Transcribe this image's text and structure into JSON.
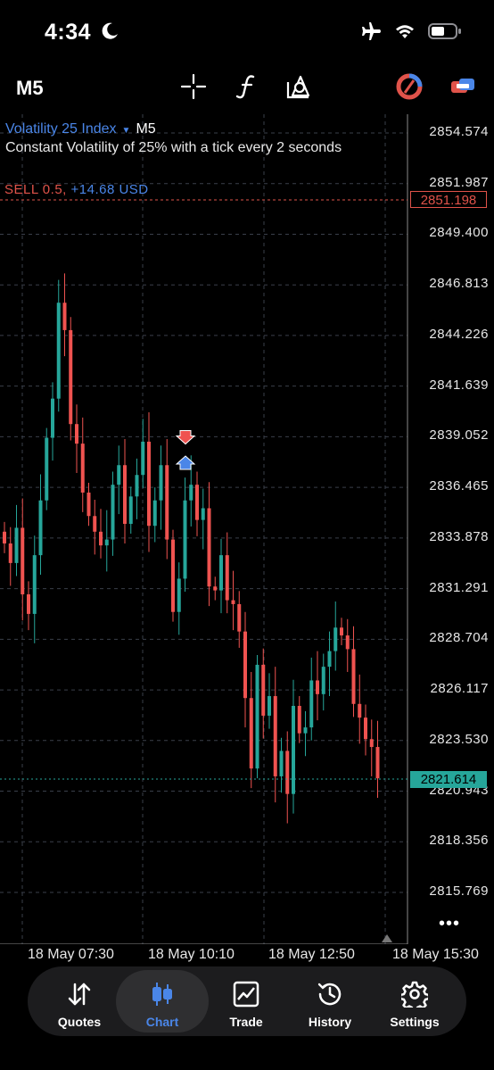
{
  "status_bar": {
    "time": "4:34"
  },
  "toolbar": {
    "timeframe": "M5"
  },
  "symbol": {
    "name": "Volatility 25 Index",
    "timeframe": "M5",
    "description": "Constant Volatility of 25% with a tick every 2 seconds"
  },
  "position": {
    "label": "SELL 0.5,",
    "pnl": "+14.68 USD"
  },
  "price_axis": [
    "2854.574",
    "2851.987",
    "2849.400",
    "2846.813",
    "2844.226",
    "2841.639",
    "2839.052",
    "2836.465",
    "2833.878",
    "2831.291",
    "2828.704",
    "2826.117",
    "2823.530",
    "2820.943",
    "2818.356",
    "2815.769"
  ],
  "bid_price": "2851.198",
  "current_price": "2821.614",
  "time_axis": [
    "18 May 07:30",
    "18 May 10:10",
    "18 May 12:50",
    "18 May 15:30"
  ],
  "more_label": "•••",
  "tabs": [
    {
      "label": "Quotes"
    },
    {
      "label": "Chart"
    },
    {
      "label": "Trade"
    },
    {
      "label": "History"
    },
    {
      "label": "Settings"
    }
  ],
  "colors": {
    "bull": "#26a69a",
    "bear": "#ef5350",
    "accent": "#4a86e8",
    "sell": "#e0534a"
  },
  "chart_data": {
    "type": "candlestick",
    "y_axis_range": [
      2815.0,
      2856.0
    ],
    "close_series": [
      2833.6,
      2832.6,
      2834.4,
      2831.0,
      2830.0,
      2833.0,
      2835.8,
      2839.0,
      2841.0,
      2845.9,
      2844.5,
      2839.7,
      2838.7,
      2836.2,
      2835.0,
      2834.2,
      2833.5,
      2833.8,
      2836.6,
      2837.6,
      2834.6,
      2836.0,
      2837.1,
      2838.8,
      2834.5,
      2835.8,
      2837.6,
      2833.8,
      2830.1,
      2831.8,
      2835.8,
      2836.6,
      2834.8,
      2835.4,
      2831.4,
      2831.2,
      2833.0,
      2830.7,
      2830.5,
      2829.1,
      2825.7,
      2822.1,
      2827.4,
      2824.8,
      2825.8,
      2821.7,
      2823.0,
      2820.8,
      2825.3,
      2823.9,
      2824.2,
      2826.6,
      2825.9,
      2827.3,
      2828.1,
      2829.3,
      2828.9,
      2828.2,
      2825.4,
      2824.7,
      2823.6,
      2823.2,
      2821.6
    ],
    "markers": [
      {
        "type": "sell",
        "price": 2839.0
      },
      {
        "type": "buy",
        "price": 2837.7
      }
    ]
  }
}
